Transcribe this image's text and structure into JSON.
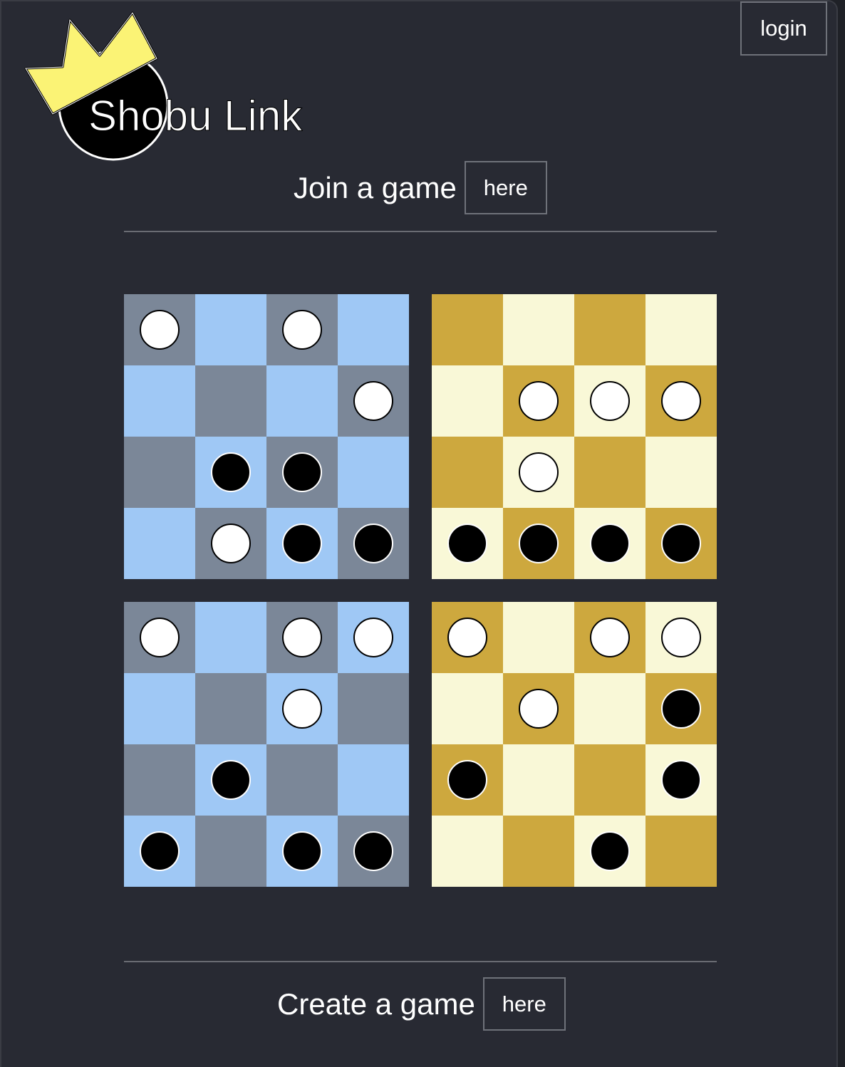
{
  "app": {
    "title": "Shobu Link",
    "login_label": "login"
  },
  "join": {
    "text": "Join a game",
    "button_label": "here"
  },
  "create": {
    "text": "Create a game",
    "button_label": "here"
  },
  "colors": {
    "background": "#282a33",
    "blue_light": "#9fc8f5",
    "blue_dark": "#7b8798",
    "wood_dark": "#cda83e",
    "wood_light": "#f9f8d7",
    "crown": "#fbf375"
  },
  "icons": {
    "logo": "crown-icon"
  },
  "boards": [
    {
      "name": "top-left",
      "theme": "blue",
      "cells": [
        [
          "w",
          "",
          "w",
          ""
        ],
        [
          "",
          "",
          "",
          "w"
        ],
        [
          "",
          "b",
          "b",
          ""
        ],
        [
          "",
          "w",
          "b",
          "b"
        ]
      ]
    },
    {
      "name": "top-right",
      "theme": "wood",
      "cells": [
        [
          "",
          "",
          "",
          ""
        ],
        [
          "",
          "w",
          "w",
          "w"
        ],
        [
          "",
          "w",
          "",
          ""
        ],
        [
          "b",
          "b",
          "b",
          "b"
        ]
      ]
    },
    {
      "name": "bottom-left",
      "theme": "blue",
      "cells": [
        [
          "w",
          "",
          "w",
          "w"
        ],
        [
          "",
          "",
          "w",
          ""
        ],
        [
          "",
          "b",
          "",
          ""
        ],
        [
          "b",
          "",
          "b",
          "b"
        ]
      ]
    },
    {
      "name": "bottom-right",
      "theme": "wood",
      "cells": [
        [
          "w",
          "",
          "w",
          "w"
        ],
        [
          "",
          "w",
          "",
          "b"
        ],
        [
          "b",
          "",
          "",
          "b"
        ],
        [
          "",
          "",
          "b",
          ""
        ]
      ]
    }
  ]
}
